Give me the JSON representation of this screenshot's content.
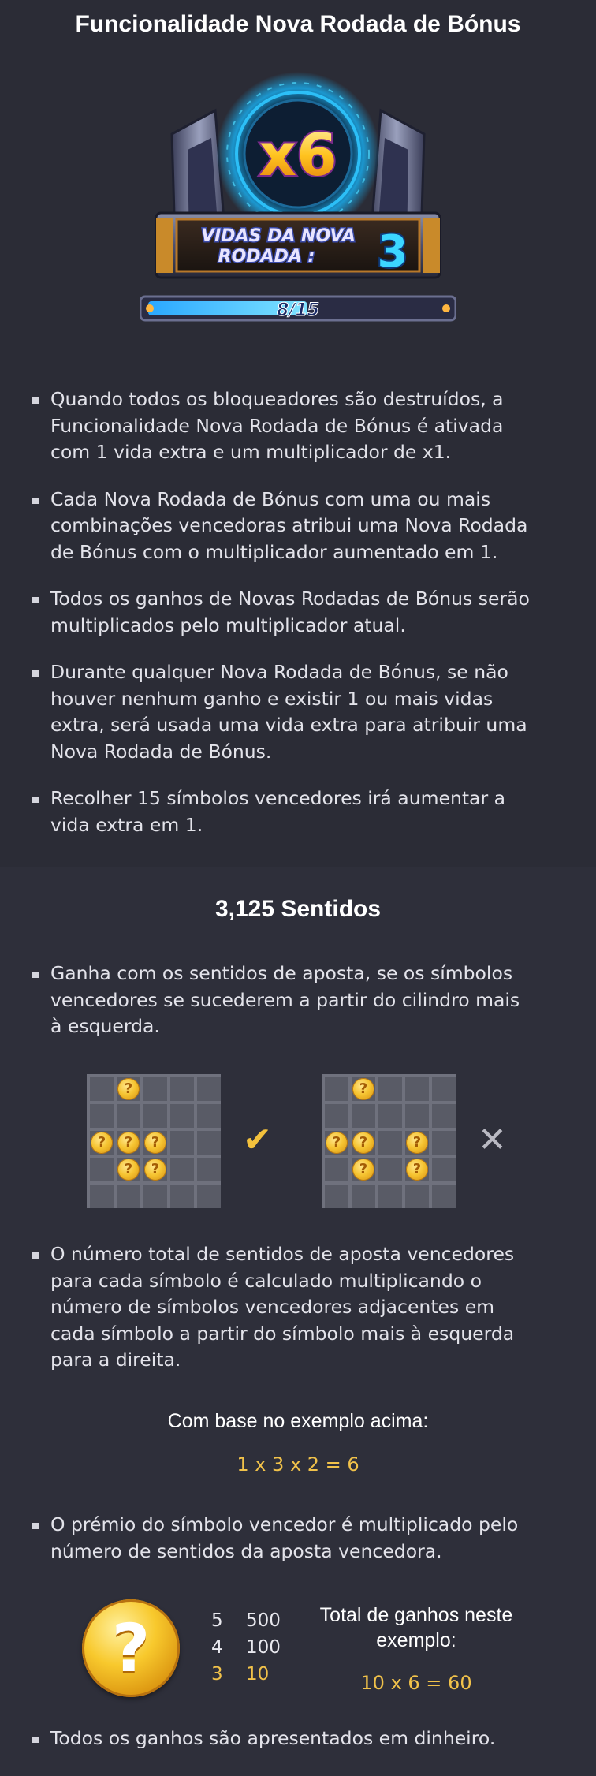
{
  "section1": {
    "title": "Funcionalidade Nova Rodada de Bónus",
    "hero": {
      "multiplier": "x6",
      "lives_label_line1": "VIDAS DA NOVA",
      "lives_label_line2": "RODADA :",
      "lives_value": "3",
      "progress_text": "8/15",
      "progress_fraction": 0.53
    },
    "bullets": [
      "Quando todos os bloqueadores são destruídos, a Funcionalidade Nova Rodada de Bónus é ativada com 1 vida extra e um multiplicador de x1.",
      "Cada Nova Rodada de Bónus com uma ou mais combinações vencedoras atribui uma Nova Rodada de Bónus com o multiplicador aumentado em 1.",
      "Todos os ganhos de Novas Rodadas de Bónus serão multiplicados pelo multiplicador atual.",
      "Durante qualquer Nova Rodada de Bónus, se não houver nenhum ganho e existir 1 ou mais vidas extra, será usada uma vida extra para atribuir uma Nova Rodada de Bónus.",
      "Recolher 15 símbolos vencedores irá aumentar a vida extra em 1."
    ]
  },
  "section2": {
    "title": "3,125 Sentidos",
    "bullet1": "Ganha com os sentidos de aposta, se os símbolos vencedores se sucederem a partir do cilindro mais à esquerda.",
    "example_grids": {
      "valid": {
        "mark": "✔",
        "coins": [
          [
            0,
            1
          ],
          [
            2,
            0
          ],
          [
            2,
            1
          ],
          [
            2,
            2
          ],
          [
            3,
            1
          ],
          [
            3,
            2
          ]
        ]
      },
      "invalid": {
        "mark": "✕",
        "coins": [
          [
            0,
            1
          ],
          [
            2,
            0
          ],
          [
            2,
            1
          ],
          [
            2,
            3
          ],
          [
            3,
            1
          ],
          [
            3,
            3
          ]
        ]
      },
      "coin_symbol": "?"
    },
    "bullet2": "O número total de sentidos de aposta vencedores para cada símbolo é calculado multiplicando o número de símbolos vencedores adjacentes em cada símbolo a partir do símbolo mais à esquerda para a direita.",
    "example_caption": "Com base no exemplo acima:",
    "example_formula": "1 x 3 x 2 = 6",
    "bullet3": "O prémio do símbolo vencedor é multiplicado pelo número de sentidos da aposta vencedora.",
    "paytable": {
      "symbol": "?",
      "rows": [
        {
          "count": "5",
          "value": "500",
          "highlight": false
        },
        {
          "count": "4",
          "value": "100",
          "highlight": false
        },
        {
          "count": "3",
          "value": "10",
          "highlight": true
        }
      ]
    },
    "total_label_line1": "Total de ganhos neste",
    "total_label_line2": "exemplo:",
    "total_formula": "10 x 6 = 60",
    "bullet4": "Todos os ganhos são apresentados em dinheiro."
  },
  "colors": {
    "background": "#2b2c36",
    "gold_text": "#f1c24a",
    "check": "#f3c13c",
    "cross": "#b9b9c2",
    "cyan": "#3cd6ff"
  }
}
